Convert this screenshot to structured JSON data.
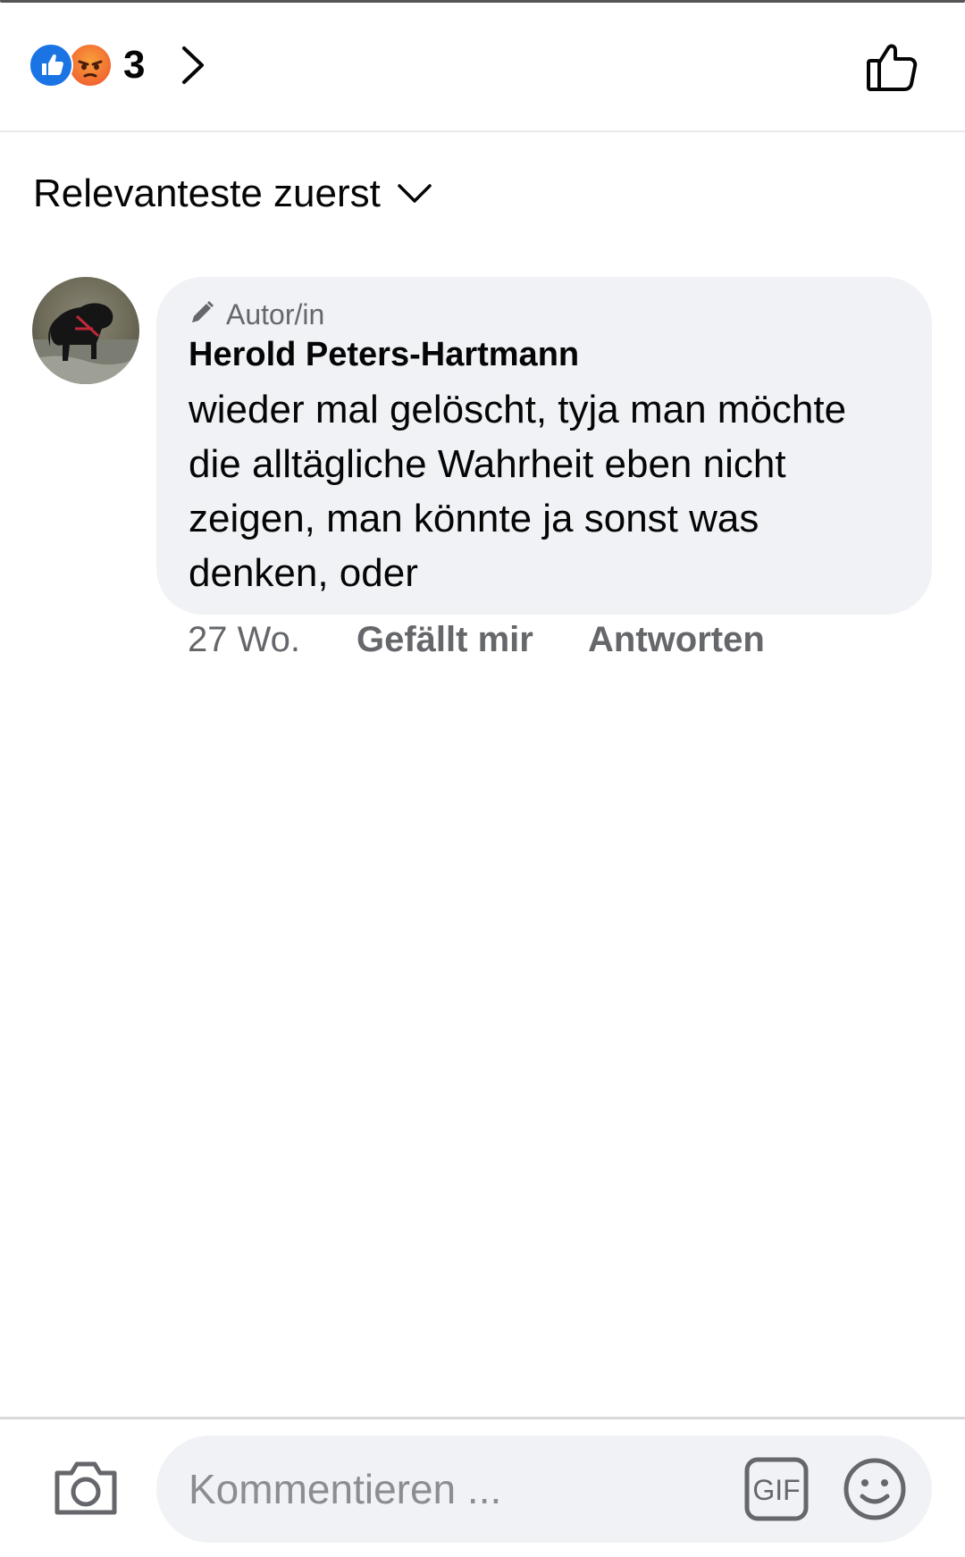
{
  "header": {
    "reaction_icons": [
      "like-reaction-icon",
      "angry-reaction-icon"
    ],
    "reaction_count": "3",
    "colors": {
      "like_blue": "#1b74e4",
      "angry_orange": "#f0582e"
    }
  },
  "sort": {
    "label": "Relevanteste zuerst"
  },
  "comment": {
    "badge": "Autor/in",
    "author": "Herold Peters-Hartmann",
    "text": "wieder mal gelöscht, tyja man möchte die alltägliche Wahrheit eben nicht zeigen, man könnte ja sonst was denken, oder",
    "time": "27 Wo.",
    "like_label": "Gefällt mir",
    "reply_label": "Antworten"
  },
  "composer": {
    "placeholder": "Kommentieren ...",
    "value": ""
  }
}
